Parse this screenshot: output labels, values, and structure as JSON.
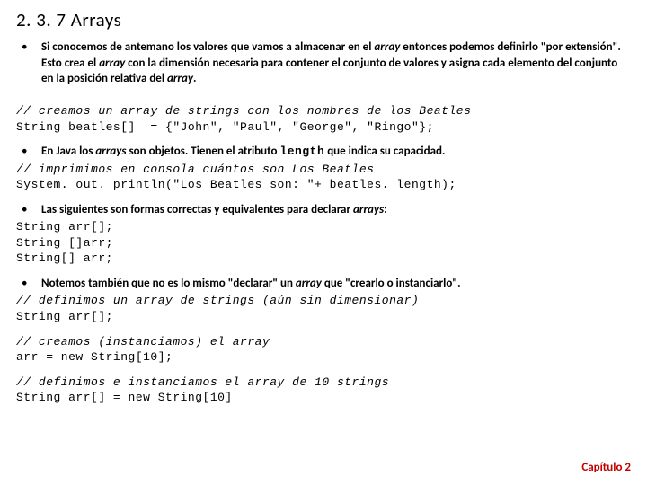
{
  "title": "2. 3. 7 Arrays",
  "bullet1": {
    "p1a": "Si conocemos de antemano los valores que vamos a almacenar en el ",
    "p1b": "array",
    "p1c": " entonces podemos definirlo \"por extensión\". Esto crea el ",
    "p1d": "array",
    "p1e": " con la dimensión necesaria para contener el conjunto de valores y asigna cada elemento del conjunto en la posición relativa del ",
    "p1f": "array",
    "p1g": "."
  },
  "code1": {
    "l1": "// creamos un array de strings con los nombres de los Beatles",
    "l2": "String beatles[]  = {\"John\", \"Paul\", \"George\", \"Ringo\"};"
  },
  "bullet2": {
    "a": "En Java los ",
    "b": "arrays",
    "c": " son objetos. Tienen el atributo ",
    "d": "length",
    "e": " que indica su capacidad."
  },
  "code2": {
    "l1": "// imprimimos en consola cuántos son Los Beatles",
    "l2": "System. out. println(\"Los Beatles son: \"+ beatles. length);"
  },
  "bullet3": {
    "a": "Las siguientes son formas correctas y equivalentes para declarar ",
    "b": "arrays",
    "c": ":"
  },
  "code3": {
    "l1": "String arr[];",
    "l2": "String []arr;",
    "l3": "String[] arr;"
  },
  "bullet4": {
    "a": "Notemos también que no es lo mismo \"declarar\" un ",
    "b": "array",
    "c": " que \"crearlo o instanciarlo\"."
  },
  "code4": {
    "l1": "// definimos un array de strings (aún sin dimensionar)",
    "l2": "String arr[];"
  },
  "code5": {
    "l1": "// creamos (instanciamos) el array",
    "l2": "arr = new String[10];"
  },
  "code6": {
    "l1": "// definimos e instanciamos el array de 10 strings",
    "l2": "String arr[] = new String[10]"
  },
  "footer": "Capítulo 2"
}
